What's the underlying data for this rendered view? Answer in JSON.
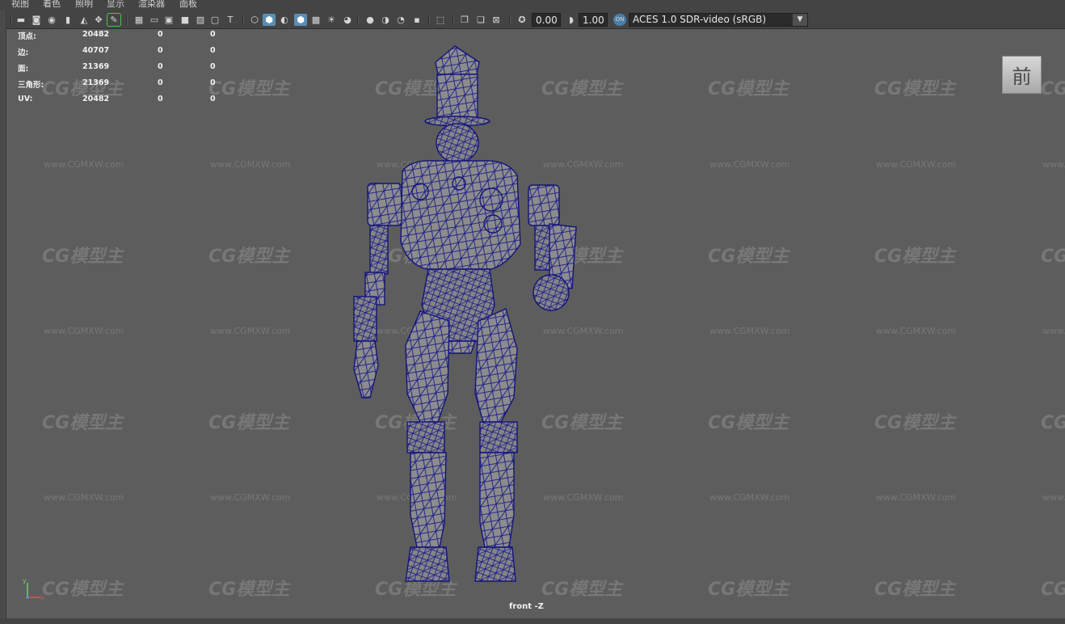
{
  "menu": [
    "视图",
    "着色",
    "照明",
    "显示",
    "渲染器",
    "面板"
  ],
  "toolbar": {
    "exposure": "0.00",
    "gamma": "1.00",
    "colorspace": "ACES 1.0 SDR-video (sRGB)",
    "buttons": [
      {
        "name": "select-camera-icon",
        "glyph": "▬"
      },
      {
        "name": "camera-attributes-icon",
        "glyph": "◙"
      },
      {
        "name": "bookmarks-icon",
        "glyph": "◉"
      },
      {
        "name": "bookmark-flag-icon",
        "glyph": "▮"
      },
      {
        "name": "image-plane-icon",
        "glyph": "◭"
      },
      {
        "name": "2d-pan-zoom-icon",
        "glyph": "✥"
      },
      {
        "name": "grease-pencil-icon",
        "glyph": "✎"
      },
      {
        "name": "grid-icon",
        "glyph": "▦"
      },
      {
        "name": "film-gate-icon",
        "glyph": "▭"
      },
      {
        "name": "resolution-gate-icon",
        "glyph": "▣"
      },
      {
        "name": "gate-mask-icon",
        "glyph": "■"
      },
      {
        "name": "field-chart-icon",
        "glyph": "▨"
      },
      {
        "name": "safe-action-icon",
        "glyph": "▢"
      },
      {
        "name": "safe-title-icon",
        "glyph": "T"
      },
      {
        "name": "wireframe-icon",
        "glyph": "⬡"
      },
      {
        "name": "smooth-shade-icon",
        "glyph": "⬢"
      },
      {
        "name": "default-material-icon",
        "glyph": "◐"
      },
      {
        "name": "wireframe-on-shaded-icon",
        "glyph": "⬢"
      },
      {
        "name": "textured-icon",
        "glyph": "▩"
      },
      {
        "name": "use-lights-icon",
        "glyph": "☀"
      },
      {
        "name": "shadows-icon",
        "glyph": "◕"
      },
      {
        "name": "screen-space-ao-icon",
        "glyph": "●"
      },
      {
        "name": "motion-blur-icon",
        "glyph": "◑"
      },
      {
        "name": "multisample-aa-icon",
        "glyph": "◔"
      },
      {
        "name": "depth-of-field-icon",
        "glyph": "▪"
      },
      {
        "name": "isolate-select-icon",
        "glyph": "⬚"
      },
      {
        "name": "xray-icon",
        "glyph": "❐"
      },
      {
        "name": "xray-active-components-icon",
        "glyph": "❏"
      },
      {
        "name": "xray-joints-icon",
        "glyph": "⊠"
      },
      {
        "name": "exposure-icon",
        "glyph": "✪"
      },
      {
        "name": "gamma-icon",
        "glyph": "◗"
      },
      {
        "name": "color-management-icon",
        "glyph": "ON"
      }
    ]
  },
  "hud": [
    {
      "label": "顶点:",
      "a": "20482",
      "b": "0",
      "c": "0"
    },
    {
      "label": "边:",
      "a": "40707",
      "b": "0",
      "c": "0"
    },
    {
      "label": "面:",
      "a": "21369",
      "b": "0",
      "c": "0"
    },
    {
      "label": "三角形:",
      "a": "21369",
      "b": "0",
      "c": "0"
    },
    {
      "label": "UV:",
      "a": "20482",
      "b": "0",
      "c": "0"
    }
  ],
  "viewcube_label": "前",
  "camera_label": "front -Z",
  "watermark": {
    "logo": "CG模型主",
    "url": "www.CGMXW.com"
  },
  "axis": {
    "y": "y",
    "x": "x"
  },
  "colors": {
    "wire": "#1a1a8c",
    "mesh_fill": "#8a8a8a",
    "background": "#5d5d5d",
    "panel": "#444444",
    "active": "#5a8fb4"
  }
}
